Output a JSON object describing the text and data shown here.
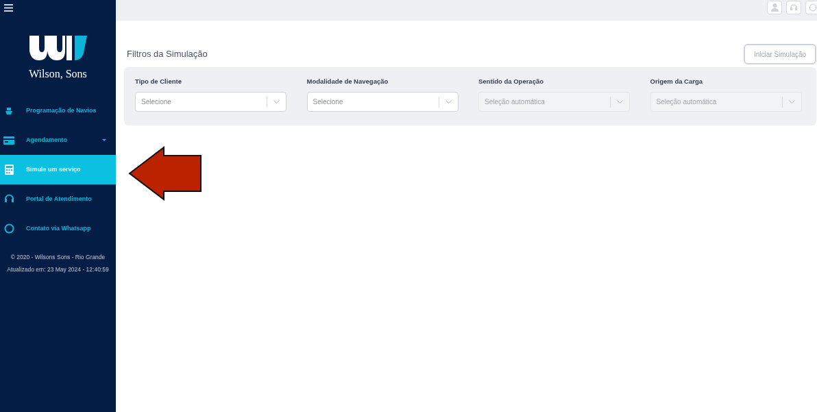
{
  "sidebar": {
    "brand": "Wilson, Sons",
    "items": [
      {
        "label": "Programação de Navios",
        "selected": false,
        "has_submenu": false
      },
      {
        "label": "Agendamento",
        "selected": false,
        "has_submenu": true
      },
      {
        "label": "Simule um serviço",
        "selected": true,
        "has_submenu": false
      },
      {
        "label": "Portal de Atendimento",
        "selected": false,
        "has_submenu": false
      },
      {
        "label": "Contato via Whatsapp",
        "selected": false,
        "has_submenu": false
      }
    ],
    "footer": [
      "© 2020 - Wilsons Sons - Rio Grande",
      "Atualizado em: 23 May 2024 - 12:40:59"
    ]
  },
  "page": {
    "title": "Filtros da Simulação",
    "start_button": {
      "label": "Iniciar Simulação",
      "disabled": true
    },
    "filters": [
      {
        "label": "Tipo de Cliente",
        "placeholder": "Selecione",
        "disabled": false
      },
      {
        "label": "Modalidade de Navegação",
        "placeholder": "Selecione",
        "disabled": false
      },
      {
        "label": "Sentido da Operação",
        "placeholder": "Seleção automática",
        "disabled": true
      },
      {
        "label": "Origem da Carga",
        "placeholder": "Seleção automática",
        "disabled": true
      }
    ]
  }
}
